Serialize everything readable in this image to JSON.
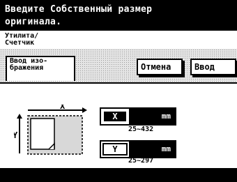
{
  "header": {
    "line1": "Введите Собственный размер",
    "line2": "оригинала."
  },
  "tab": {
    "line1": "Утилита/",
    "line2": "Счетчик"
  },
  "panel": {
    "tab_line1": "Ввод изо-",
    "tab_line2": "бражения",
    "cancel_label": "Отмена",
    "enter_label": "Ввод"
  },
  "fields": {
    "x": {
      "key": "X",
      "unit": "mm",
      "range": "25~432"
    },
    "y": {
      "key": "Y",
      "unit": "mm",
      "range": "25~297"
    }
  },
  "diagram": {
    "x_label": "X",
    "y_label": "Y"
  }
}
